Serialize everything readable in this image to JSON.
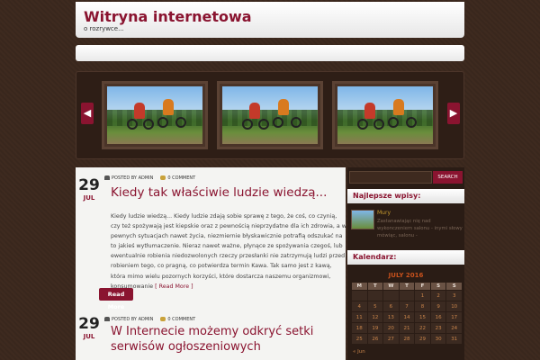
{
  "header": {
    "title": "Witryna internetowa",
    "description": "o rozrywce..."
  },
  "slider": {
    "prev_icon": "chevron-left-icon",
    "next_icon": "chevron-right-icon"
  },
  "posts": [
    {
      "day": "29",
      "month": "JUL",
      "author": "POSTED BY ADMIN",
      "comments": "0 COMMENT",
      "title": "Kiedy tak właściwie ludzie wiedzą...",
      "excerpt": "Kiedy ludzie wiedzą... Kiedy ludzie zdają sobie sprawę z tego, że coś, co czynią, czy też spożywają jest kiepskie oraz z pewnością nieprzydatne dla ich zdrowia, a w pewnych sytuacjach nawet życia, niezmiernie błyskawicznie potrafią odszukać na to jakieś wytłumaczenie. Nieraz nawet ważne, płynące ze spożywania czegoś, lub ewentualnie robienia niedozwolonych rzeczy przesłanki nie zatrzymują ludzi przed robieniem tego, co pragną, co potwierdza termin Kawa. Tak samo jest z kawą, która mimo wielu pozornych korzyści, które dostarcza naszemu organizmowi, konsumowanie",
      "more_link": "[ Read More ]",
      "read_more_button": "Read More"
    },
    {
      "day": "29",
      "month": "JUL",
      "author": "POSTED BY ADMIN",
      "comments": "0 COMMENT",
      "title_line1": "W Internecie możemy odkryć setki",
      "title_line2": "serwisów ogłoszeniowych"
    }
  ],
  "sidebar": {
    "search_button": "SEARCH",
    "recent_title": "Najlepsze wpisy:",
    "recent_item_title": "Mury",
    "recent_item_text": "Zastanawiając nię nad wykonczeniem salonu - inymi słowy mówiąc, salonu -",
    "calendar_title": "Kalendarz:",
    "calendar": {
      "caption": "JULY 2016",
      "headers": [
        "M",
        "T",
        "W",
        "T",
        "F",
        "S",
        "S"
      ],
      "rows": [
        [
          "",
          "",
          "",
          "",
          "1",
          "2",
          "3"
        ],
        [
          "4",
          "5",
          "6",
          "7",
          "8",
          "9",
          "10"
        ],
        [
          "11",
          "12",
          "13",
          "14",
          "15",
          "16",
          "17"
        ],
        [
          "18",
          "19",
          "20",
          "21",
          "22",
          "23",
          "24"
        ],
        [
          "25",
          "26",
          "27",
          "28",
          "29",
          "30",
          "31"
        ]
      ],
      "prev_link": "« Jun"
    }
  }
}
